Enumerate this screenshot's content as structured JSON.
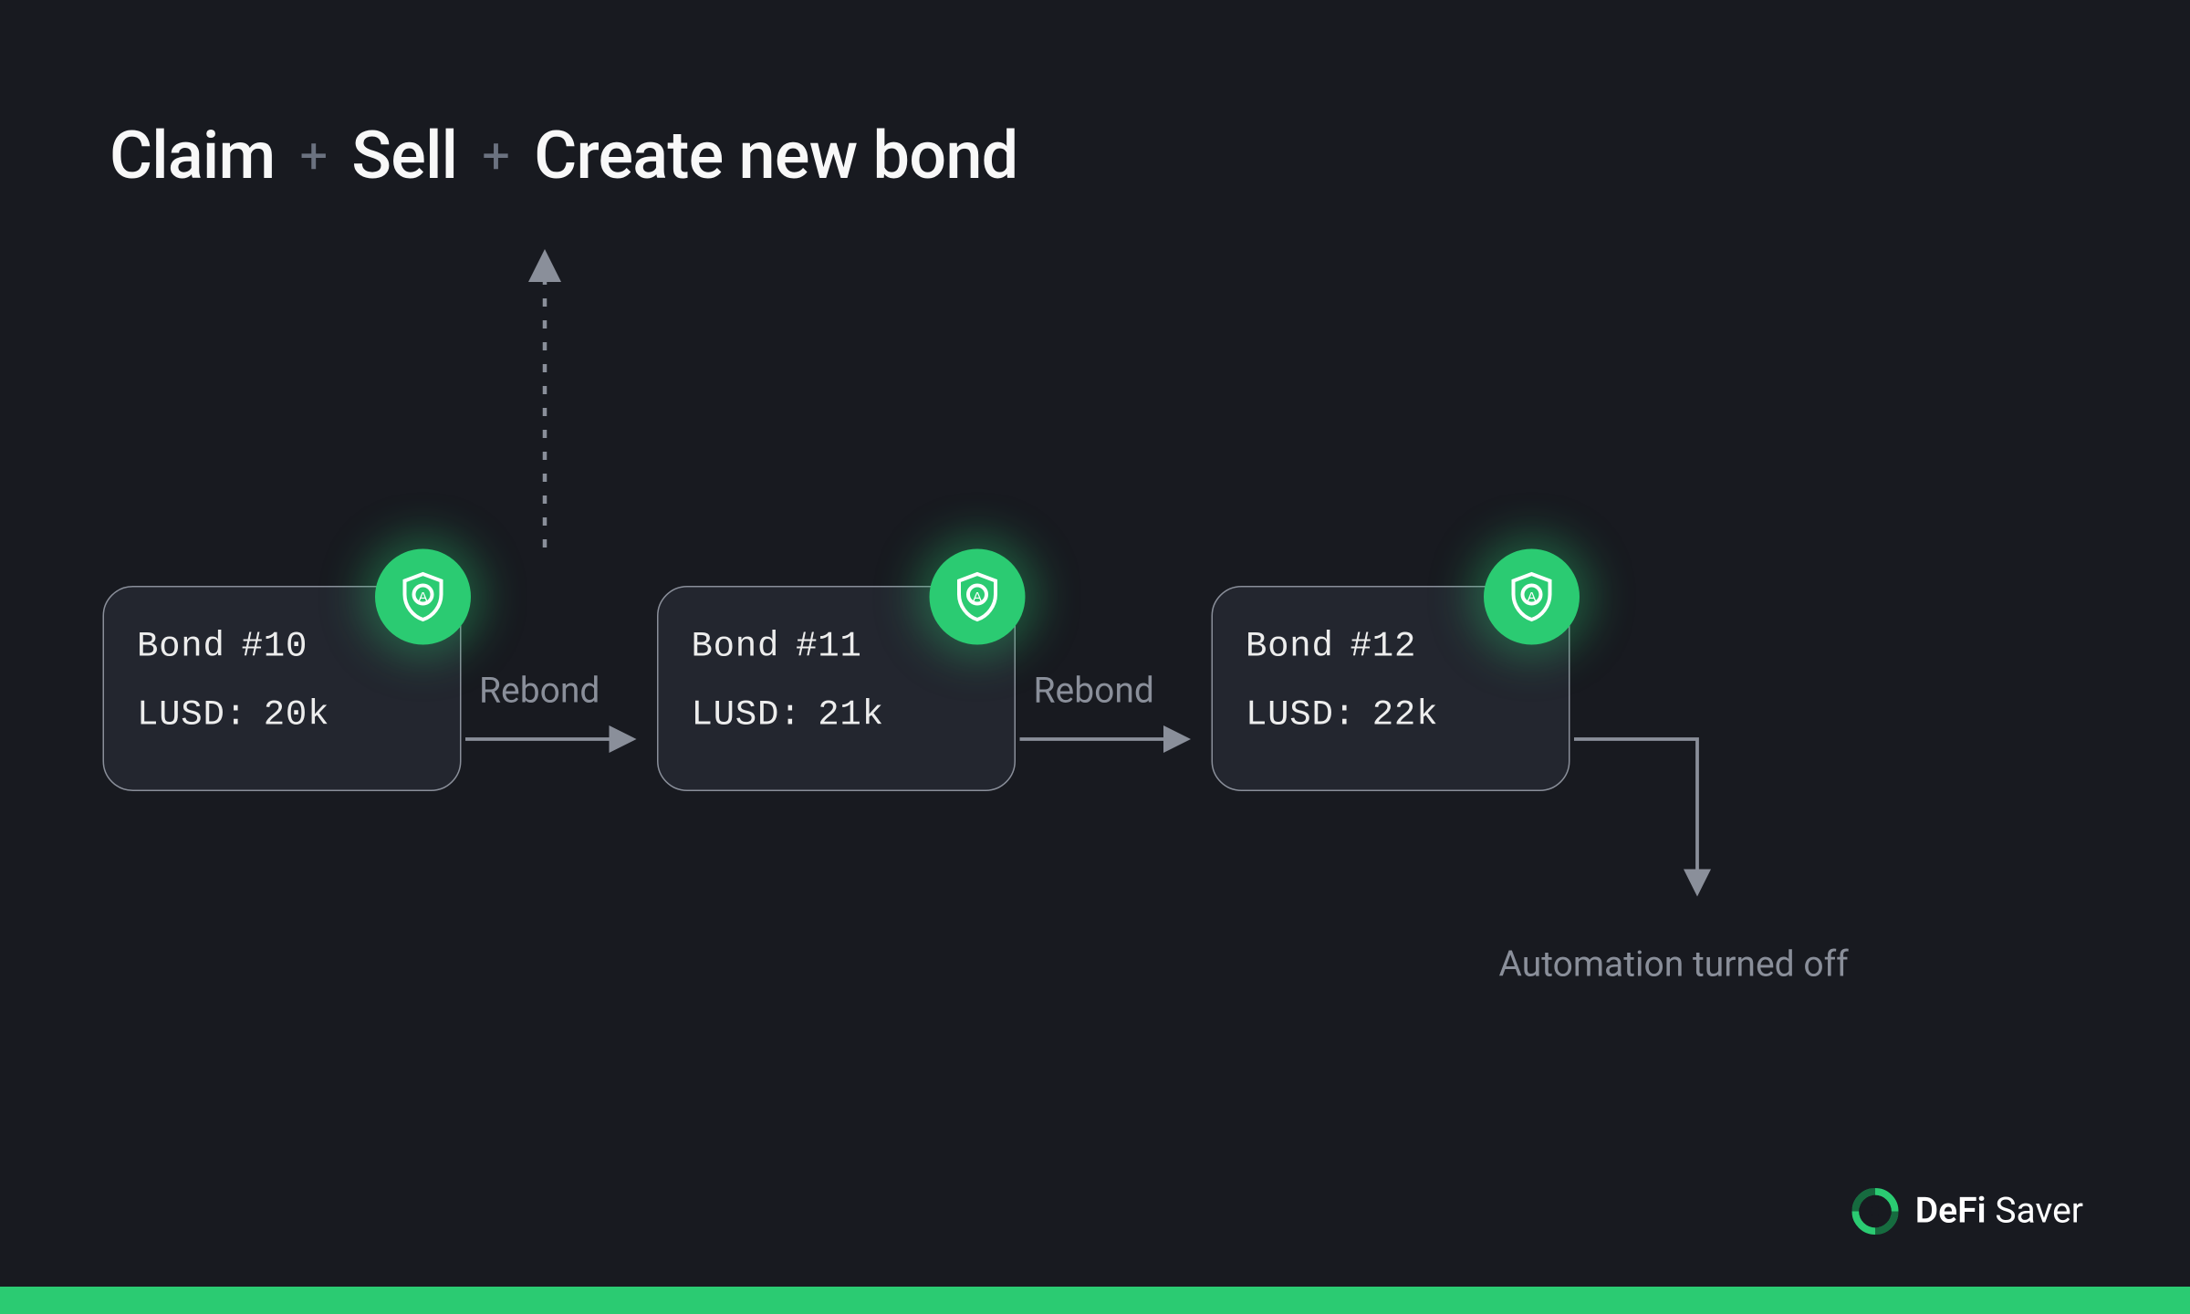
{
  "title": {
    "part1": "Claim",
    "sep": "+",
    "part2": "Sell",
    "part3": "Create new bond"
  },
  "cards": [
    {
      "bond_label": "Bond",
      "bond_num": "#10",
      "lusd_label": "LUSD:",
      "lusd_val": "20k"
    },
    {
      "bond_label": "Bond",
      "bond_num": "#11",
      "lusd_label": "LUSD:",
      "lusd_val": "21k"
    },
    {
      "bond_label": "Bond",
      "bond_num": "#12",
      "lusd_label": "LUSD:",
      "lusd_val": "22k"
    }
  ],
  "arrows": {
    "rebond1": "Rebond",
    "rebond2": "Rebond"
  },
  "automation_off": "Automation turned off",
  "brand": {
    "name_bold": "DeFi",
    "name_light": "Saver"
  },
  "colors": {
    "accent": "#2BCB72",
    "bg": "#181A20",
    "card": "#23262F",
    "muted": "#8A8F9A"
  }
}
